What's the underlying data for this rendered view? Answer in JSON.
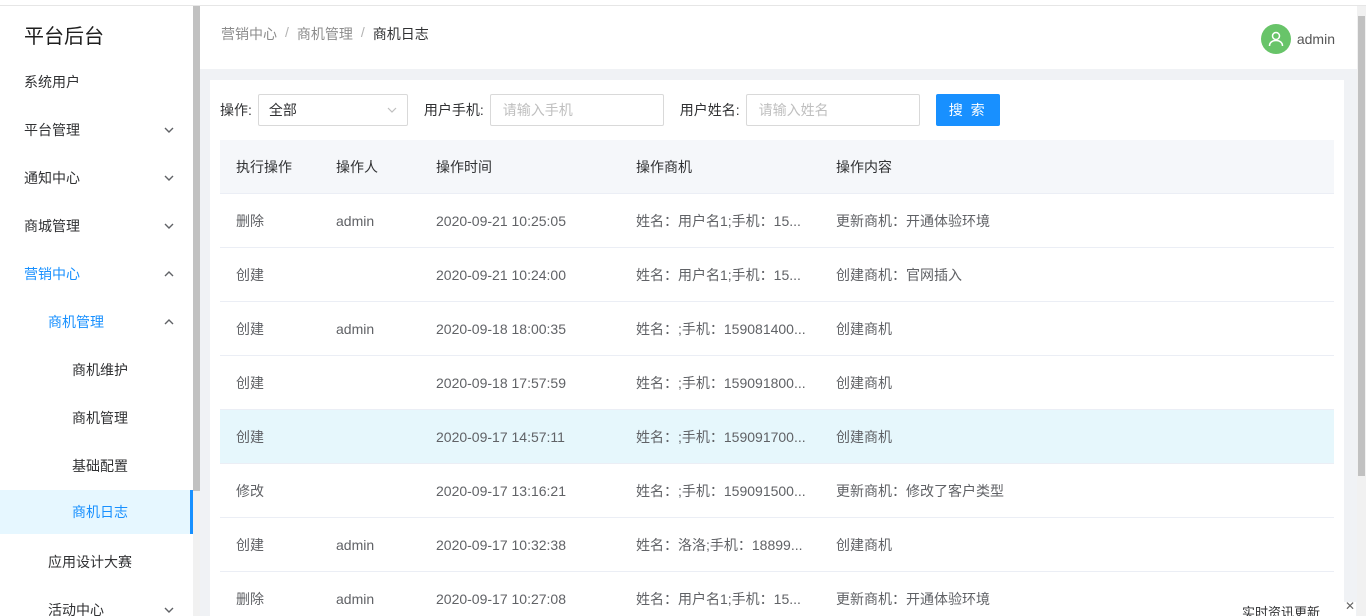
{
  "sidebar": {
    "brand": "平台后台",
    "items": [
      {
        "label": "系统用户"
      },
      {
        "label": "平台管理"
      },
      {
        "label": "通知中心"
      },
      {
        "label": "商城管理"
      },
      {
        "label": "营销中心"
      },
      {
        "label": "商机管理"
      },
      {
        "label": "商机维护"
      },
      {
        "label": "商机管理"
      },
      {
        "label": "基础配置"
      },
      {
        "label": "商机日志"
      },
      {
        "label": "应用设计大赛"
      },
      {
        "label": "活动中心"
      }
    ]
  },
  "header": {
    "breadcrumb": [
      "营销中心",
      "商机管理",
      "商机日志"
    ],
    "separator": "/",
    "username": "admin"
  },
  "filter": {
    "op_label": "操作:",
    "op_value": "全部",
    "phone_label": "用户手机:",
    "phone_placeholder": "请输入手机",
    "name_label": "用户姓名:",
    "name_placeholder": "请输入姓名",
    "search_button": "搜 索"
  },
  "table": {
    "columns": [
      "执行操作",
      "操作人",
      "操作时间",
      "操作商机",
      "操作内容"
    ],
    "rows": [
      [
        "删除",
        "admin",
        "2020-09-21 10:25:05",
        "姓名：用户名1;手机：15...",
        "更新商机：开通体验环境"
      ],
      [
        "创建",
        "",
        "2020-09-21 10:24:00",
        "姓名：用户名1;手机：15...",
        "创建商机：官网插入"
      ],
      [
        "创建",
        "admin",
        "2020-09-18 18:00:35",
        "姓名：;手机：159081400...",
        "创建商机"
      ],
      [
        "创建",
        "",
        "2020-09-18 17:57:59",
        "姓名：;手机：159091800...",
        "创建商机"
      ],
      [
        "创建",
        "",
        "2020-09-17 14:57:11",
        "姓名：;手机：159091700...",
        "创建商机"
      ],
      [
        "修改",
        "",
        "2020-09-17 13:16:21",
        "姓名：;手机：159091500...",
        "更新商机：修改了客户类型"
      ],
      [
        "创建",
        "admin",
        "2020-09-17 10:32:38",
        "姓名：洛洛;手机：18899...",
        "创建商机"
      ],
      [
        "删除",
        "admin",
        "2020-09-17 10:27:08",
        "姓名：用户名1;手机：15...",
        "更新商机：开通体验环境"
      ]
    ]
  },
  "float_tip": "实时资讯更新",
  "colors": {
    "accent": "#1890ff",
    "avatar": "#68c469",
    "highlight_row": "#e6f7fc"
  }
}
